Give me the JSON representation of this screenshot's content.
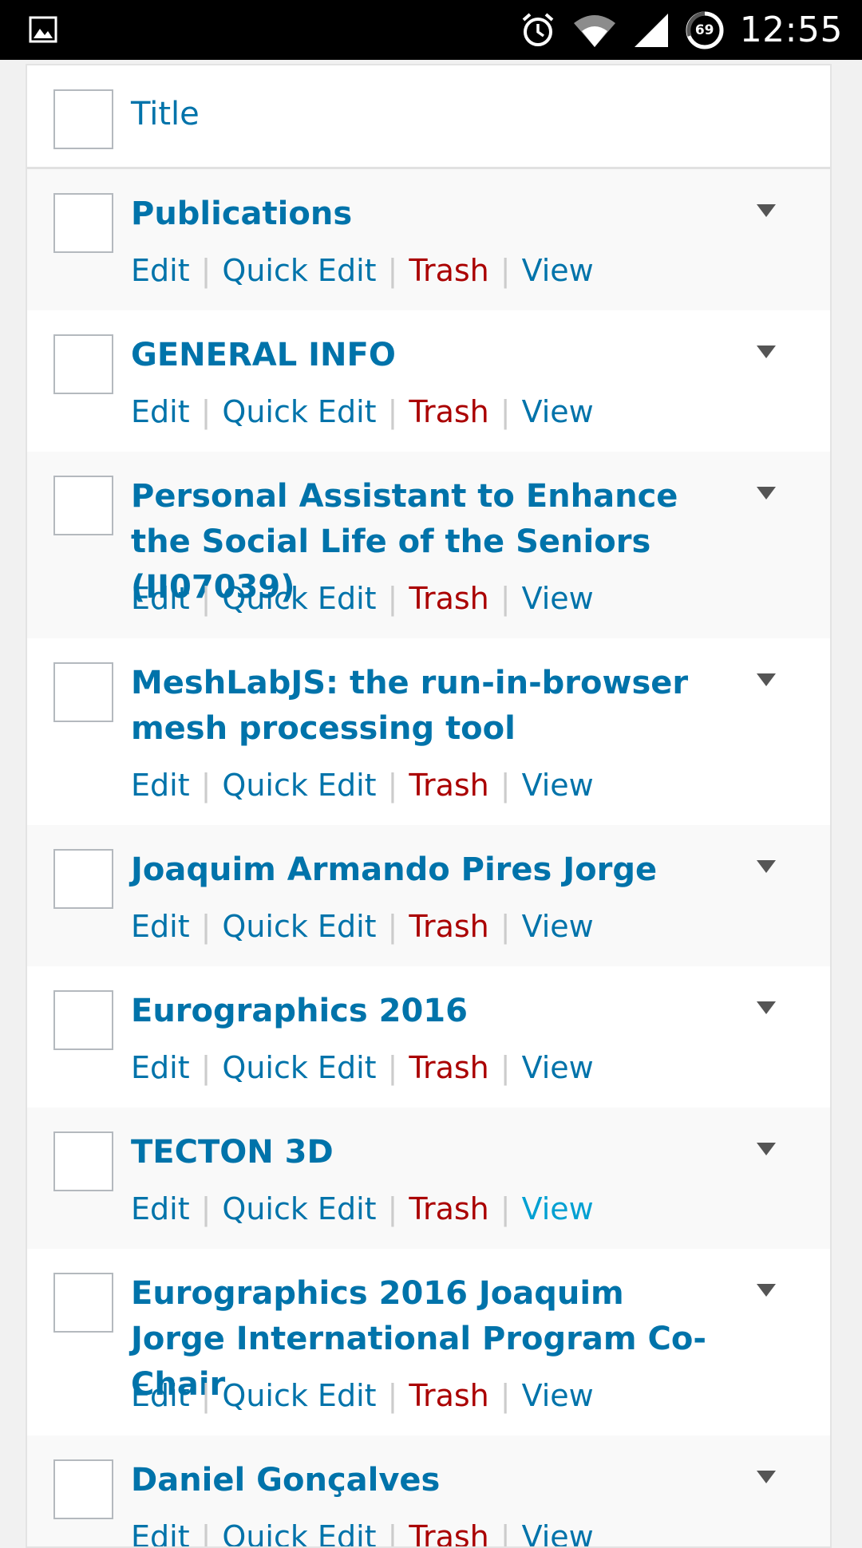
{
  "status_bar": {
    "time": "12:55",
    "battery": "69",
    "icons": [
      "image-icon",
      "alarm-icon",
      "wifi-icon",
      "cell-signal-icon",
      "battery-icon"
    ]
  },
  "table": {
    "header": {
      "title": "Title"
    },
    "action_labels": {
      "edit": "Edit",
      "quick_edit": "Quick Edit",
      "trash": "Trash",
      "view": "View"
    },
    "rows": [
      {
        "title": "Publications"
      },
      {
        "title": "GENERAL INFO"
      },
      {
        "title": "Personal Assistant to Enhance the Social Life of the Seniors (II07039)"
      },
      {
        "title": "MeshLabJS: the run-in-browser mesh processing tool"
      },
      {
        "title": "Joaquim Armando Pires Jorge"
      },
      {
        "title": "Eurographics 2016"
      },
      {
        "title": "TECTON 3D"
      },
      {
        "title": "Eurographics 2016 Joaquim Jorge International Program Co-Chair"
      },
      {
        "title": "Daniel Gonçalves"
      }
    ]
  },
  "colors": {
    "link": "#0073aa",
    "trash": "#aa0000",
    "link_hover": "#00a0d2"
  }
}
